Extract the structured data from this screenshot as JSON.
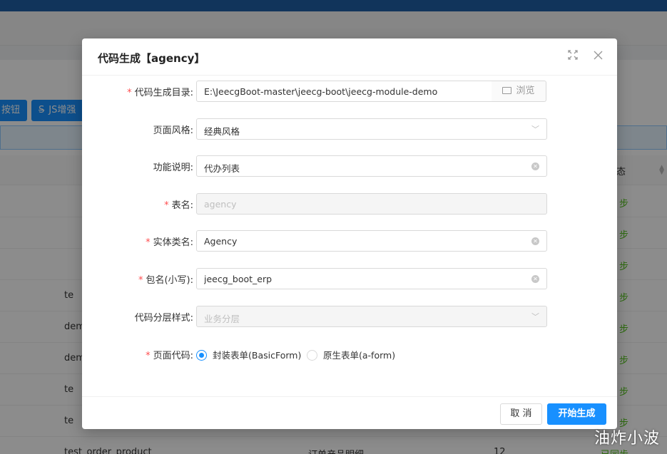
{
  "background": {
    "toolbar_buttons": [
      "按钮",
      "JS增强"
    ],
    "status_header": "态",
    "rows": [
      {
        "code": "",
        "desc": "",
        "num": "",
        "sync": "步"
      },
      {
        "code": "",
        "desc": "",
        "num": "",
        "sync": "步"
      },
      {
        "code": "",
        "desc": "",
        "num": "",
        "sync": "步"
      },
      {
        "code": "te",
        "desc": "",
        "num": "",
        "sync": "步"
      },
      {
        "code": "dem",
        "desc": "",
        "num": "",
        "sync": "步"
      },
      {
        "code": "dem",
        "desc": "",
        "num": "",
        "sync": "步"
      },
      {
        "code": "te",
        "desc": "",
        "num": "",
        "sync": "步"
      },
      {
        "code": "te",
        "desc": "",
        "num": "",
        "sync": "步"
      },
      {
        "code": "test_order_product",
        "desc": "订单产品明细",
        "num": "12",
        "sync": "已同步"
      }
    ]
  },
  "modal": {
    "title": "代码生成【agency】",
    "fields": {
      "output_dir": {
        "label": "代码生成目录:",
        "required": true,
        "value": "E:\\JeecgBoot-master\\jeecg-boot\\jeecg-module-demo",
        "browse_label": "浏览"
      },
      "page_style": {
        "label": "页面风格:",
        "required": false,
        "value": "经典风格"
      },
      "description": {
        "label": "功能说明:",
        "required": false,
        "value": "代办列表"
      },
      "table_name": {
        "label": "表名:",
        "required": true,
        "value": "agency"
      },
      "entity_name": {
        "label": "实体类名:",
        "required": true,
        "value": "Agency"
      },
      "package_name": {
        "label": "包名(小写):",
        "required": true,
        "value": "jeecg_boot_erp"
      },
      "layer_style": {
        "label": "代码分层样式:",
        "required": false,
        "placeholder": "业务分层"
      },
      "page_code": {
        "label": "页面代码:",
        "required": true,
        "options": [
          "封装表单(BasicForm)",
          "原生表单(a-form)"
        ],
        "selected": 0
      }
    },
    "footer": {
      "cancel_label": "取 消",
      "submit_label": "开始生成"
    }
  },
  "watermark": "油炸小波",
  "colors": {
    "primary": "#1890ff",
    "required": "#ff4d4f",
    "topbar": "#1f5fa6",
    "success": "#52c41a"
  }
}
